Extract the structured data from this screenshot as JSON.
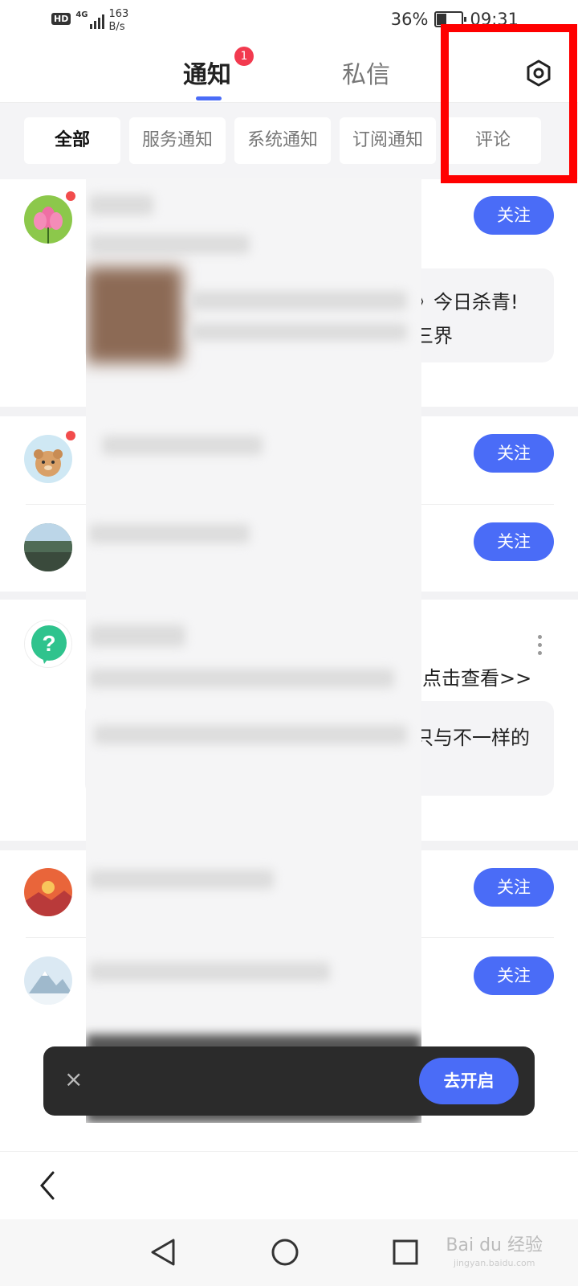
{
  "status_bar": {
    "network_badge": "HD",
    "network_type": "4G",
    "speed_value": "163",
    "speed_unit": "B/s",
    "battery": "36%",
    "time": "09:31"
  },
  "tabs": {
    "notify": "通知",
    "notify_badge": "1",
    "dm": "私信"
  },
  "filters": [
    "全部",
    "服务通知",
    "系统通知",
    "订阅通知",
    "评论"
  ],
  "feed": {
    "follow_label": "关注",
    "item1_line1": "》今日杀青!",
    "item1_line2": "三界",
    "item4_link": "点击查看>>",
    "item4_quote": "只与不一样的"
  },
  "toast": {
    "close": "×",
    "action": "去开启"
  },
  "watermark": {
    "brand": "Bai du 经验",
    "url": "jingyan.baidu.com"
  },
  "colors": {
    "accent": "#4a6cf7",
    "badge": "#f23a4f",
    "highlight": "#ff0000"
  }
}
